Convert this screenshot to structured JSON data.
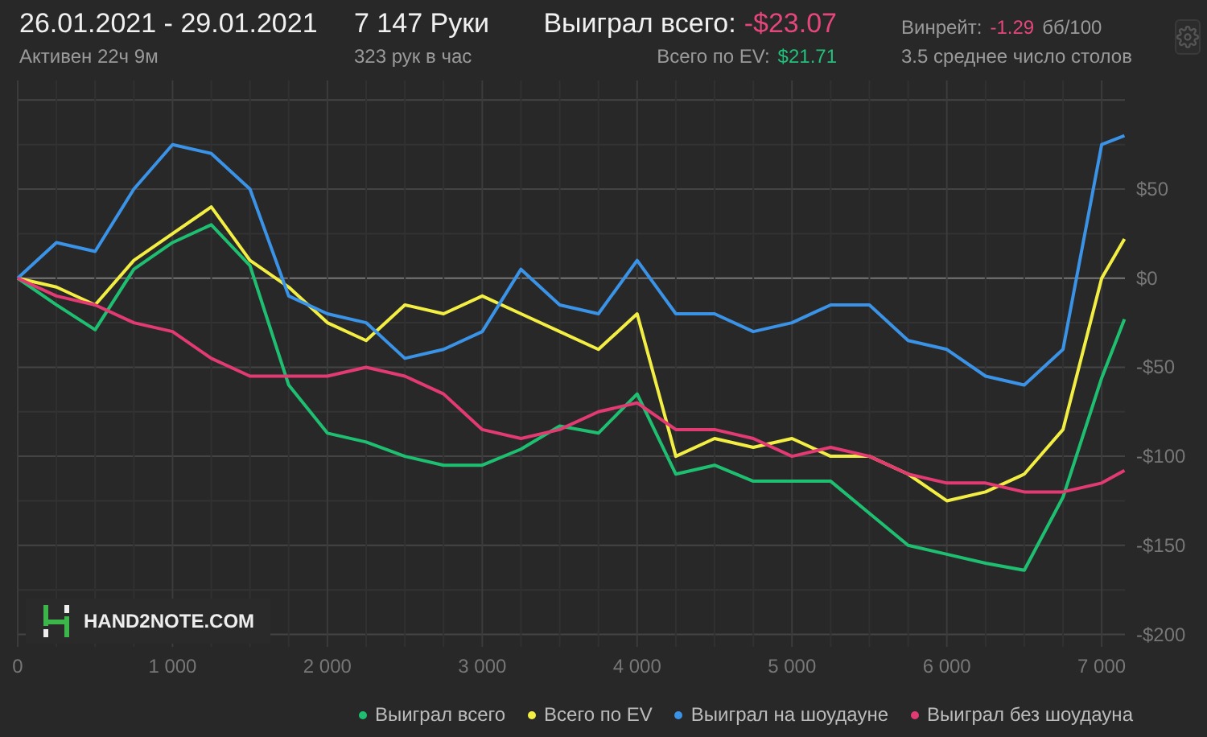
{
  "header": {
    "date_range": "26.01.2021 - 29.01.2021",
    "active": "Активен 22ч 9м",
    "hands": "7 147 Руки",
    "hands_per_hour": "323 рук в час",
    "won_label": "Выиграл всего:",
    "won_value": "-$23.07",
    "ev_label": "Всего по EV:",
    "ev_value": "$21.71",
    "winrate_label": "Винрейт:",
    "winrate_value": "-1.29",
    "winrate_unit": "бб/100",
    "tables": "3.5 среднее число столов"
  },
  "logo": {
    "text": "HAND**2**NOTE.COM"
  },
  "chart": {
    "chart_data": {
      "type": "line",
      "grid": true,
      "xlim": [
        0,
        7150
      ],
      "ylim": [
        -207,
        111
      ],
      "xticks": [
        {
          "value": 0,
          "label": "0"
        },
        {
          "value": 1000,
          "label": "1 000"
        },
        {
          "value": 2000,
          "label": "2 000"
        },
        {
          "value": 3000,
          "label": "3 000"
        },
        {
          "value": 4000,
          "label": "4 000"
        },
        {
          "value": 5000,
          "label": "5 000"
        },
        {
          "value": 6000,
          "label": "6 000"
        },
        {
          "value": 7000,
          "label": "7 000"
        }
      ],
      "yticks": [
        {
          "value": 50,
          "label": "$50"
        },
        {
          "value": 0,
          "label": "$0"
        },
        {
          "value": -50,
          "label": "-$50"
        },
        {
          "value": -100,
          "label": "-$100"
        },
        {
          "value": -150,
          "label": "-$150"
        },
        {
          "value": -200,
          "label": "-$200"
        }
      ],
      "x": [
        0,
        250,
        500,
        750,
        1000,
        1250,
        1500,
        1750,
        2000,
        2250,
        2500,
        2750,
        3000,
        3250,
        3500,
        3750,
        4000,
        4250,
        4500,
        4750,
        5000,
        5250,
        5500,
        5750,
        6000,
        6250,
        6500,
        6750,
        7000,
        7147
      ],
      "series": [
        {
          "name": "Выиграл всего",
          "color": "#1fbf72",
          "values": [
            0,
            -15,
            -29,
            5,
            20,
            30,
            7,
            -60,
            -87,
            -92,
            -100,
            -105,
            -105,
            -96,
            -83,
            -87,
            -65,
            -110,
            -105,
            -114,
            -114,
            -114,
            -132,
            -150,
            -155,
            -160,
            -164,
            -123,
            -56,
            -23
          ]
        },
        {
          "name": "Всего по EV",
          "color": "#f2ee44",
          "values": [
            0,
            -5,
            -15,
            10,
            25,
            40,
            10,
            -5,
            -25,
            -35,
            -15,
            -20,
            -10,
            -20,
            -30,
            -40,
            -20,
            -100,
            -90,
            -95,
            -90,
            -100,
            -100,
            -110,
            -125,
            -120,
            -110,
            -85,
            0,
            22
          ]
        },
        {
          "name": "Выиграл на шоудауне",
          "color": "#3a93e6",
          "values": [
            0,
            20,
            15,
            50,
            75,
            70,
            50,
            -10,
            -20,
            -25,
            -45,
            -40,
            -30,
            5,
            -15,
            -20,
            10,
            -20,
            -20,
            -30,
            -25,
            -15,
            -15,
            -35,
            -40,
            -55,
            -60,
            -40,
            75,
            80
          ]
        },
        {
          "name": "Выиграл без шоудауна",
          "color": "#e23a72",
          "values": [
            0,
            -10,
            -15,
            -25,
            -30,
            -45,
            -55,
            -55,
            -55,
            -50,
            -55,
            -65,
            -85,
            -90,
            -85,
            -75,
            -70,
            -85,
            -85,
            -90,
            -100,
            -95,
            -100,
            -110,
            -115,
            -115,
            -120,
            -120,
            -115,
            -108
          ]
        }
      ]
    }
  }
}
